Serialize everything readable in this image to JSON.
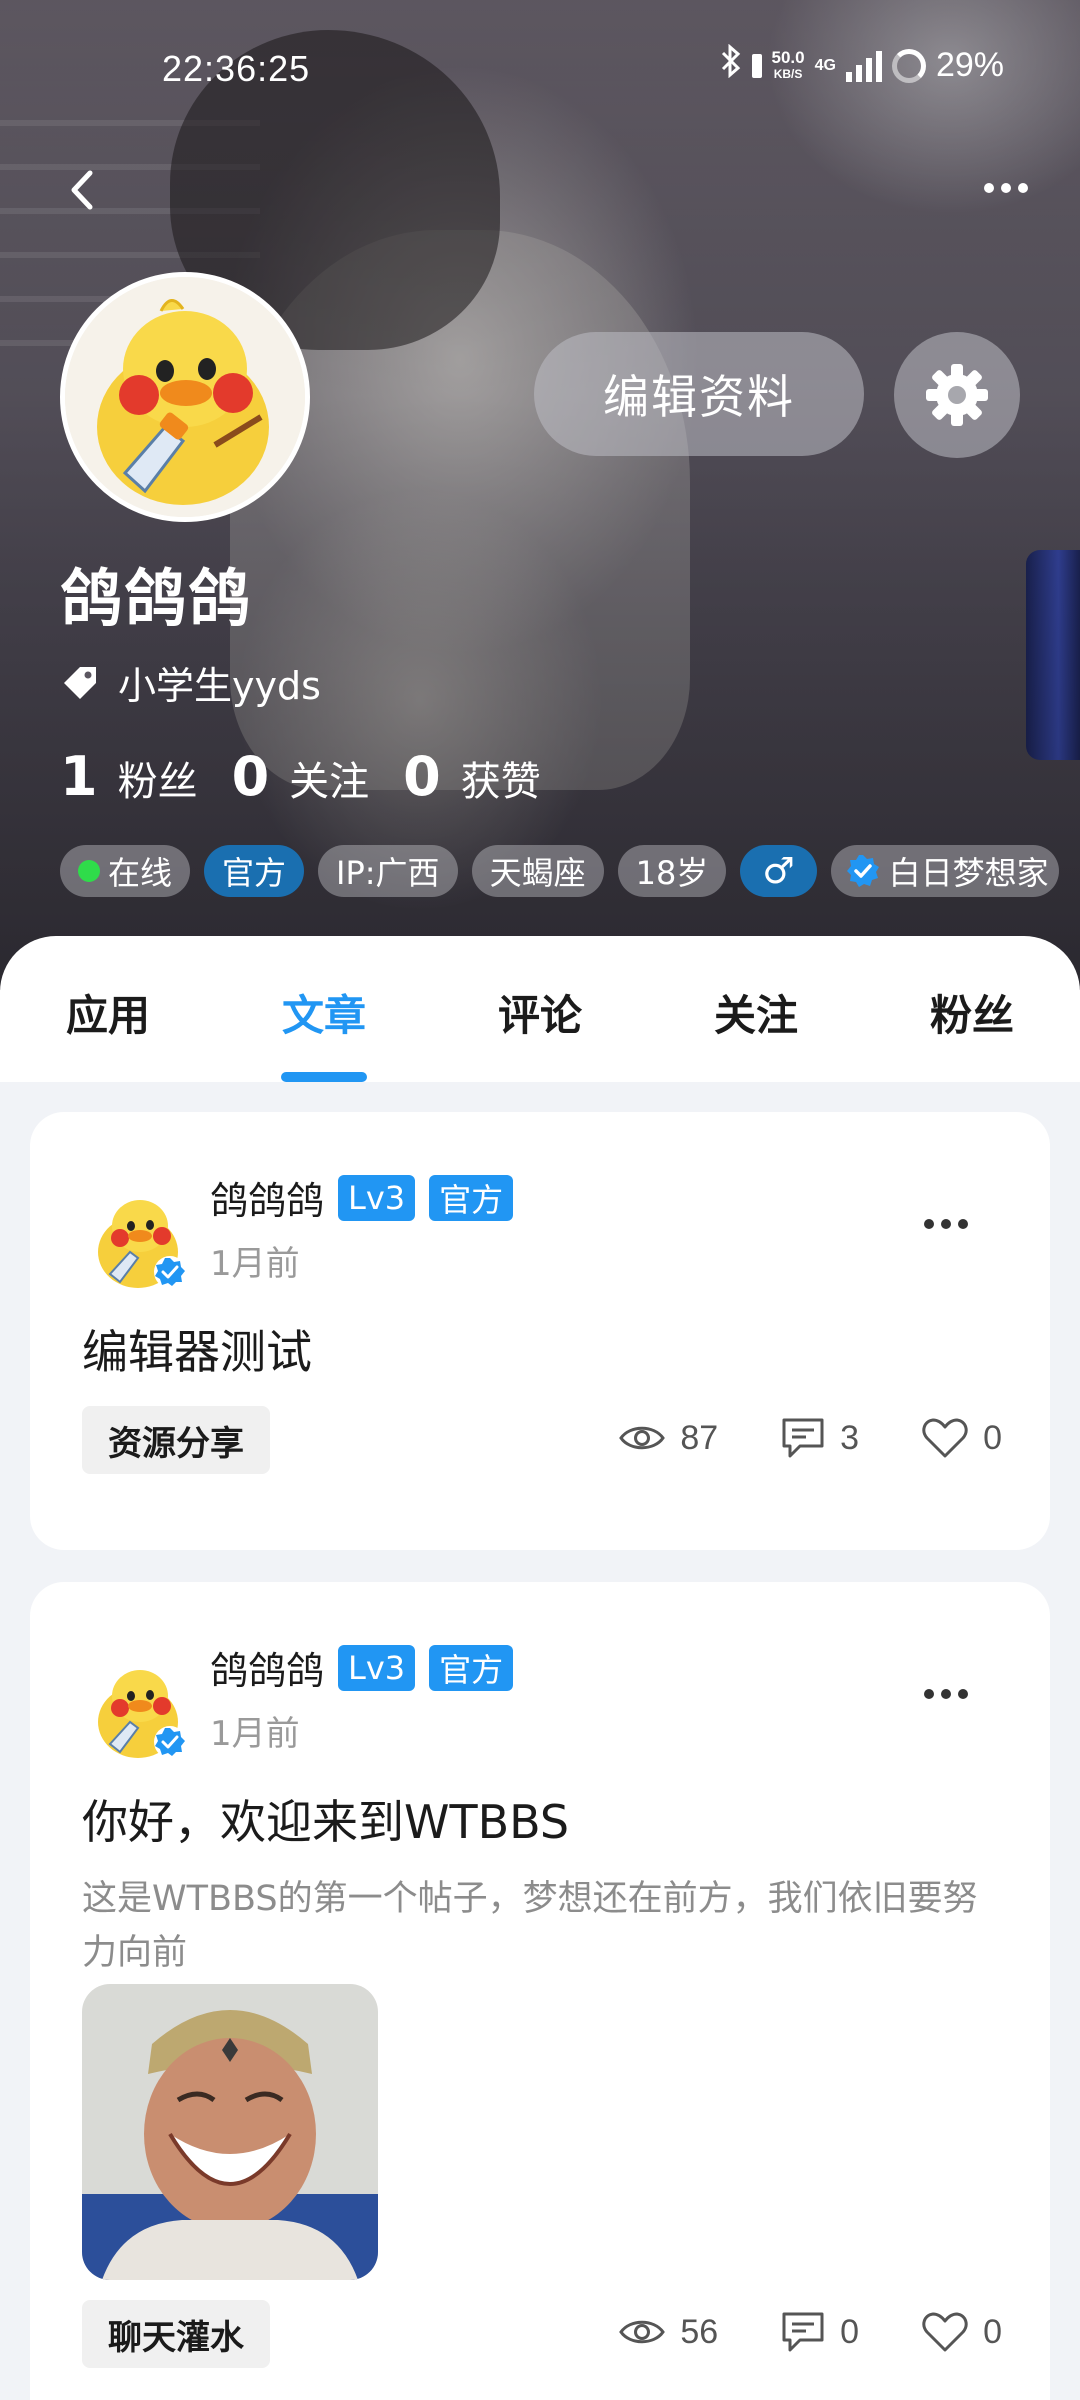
{
  "status_bar": {
    "time": "22:36:25",
    "net_speed_value": "50.0",
    "net_speed_unit": "KB/S",
    "network_type": "4G",
    "battery": "29%"
  },
  "profile": {
    "edit_button_label": "编辑资料",
    "username": "鸽鸽鸽",
    "signature": "小学生yyds",
    "stats": [
      {
        "value": "1",
        "label": "粉丝"
      },
      {
        "value": "0",
        "label": "关注"
      },
      {
        "value": "0",
        "label": "获赞"
      }
    ],
    "tags": {
      "online": "在线",
      "official": "官方",
      "ip": "IP:广西",
      "zodiac": "天蝎座",
      "age": "18岁",
      "gender_symbol": "♂",
      "title": "白日梦想家"
    }
  },
  "tabs": [
    {
      "label": "应用",
      "active": false
    },
    {
      "label": "文章",
      "active": true
    },
    {
      "label": "评论",
      "active": false
    },
    {
      "label": "关注",
      "active": false
    },
    {
      "label": "粉丝",
      "active": false
    }
  ],
  "posts": [
    {
      "author": "鸽鸽鸽",
      "level": "Lv3",
      "badge": "官方",
      "time": "1月前",
      "title": "编辑器测试",
      "category": "资源分享",
      "views": "87",
      "comments": "3",
      "likes": "0"
    },
    {
      "author": "鸽鸽鸽",
      "level": "Lv3",
      "badge": "官方",
      "time": "1月前",
      "title": "你好，欢迎来到WTBBS",
      "excerpt": "这是WTBBS的第一个帖子，梦想还在前方，我们依旧要努力向前",
      "category": "聊天灌水",
      "views": "56",
      "comments": "0",
      "likes": "0"
    }
  ],
  "colors": {
    "accent": "#2196f3",
    "online": "#2fdc4a",
    "tag_blue": "#1a6fb0"
  }
}
